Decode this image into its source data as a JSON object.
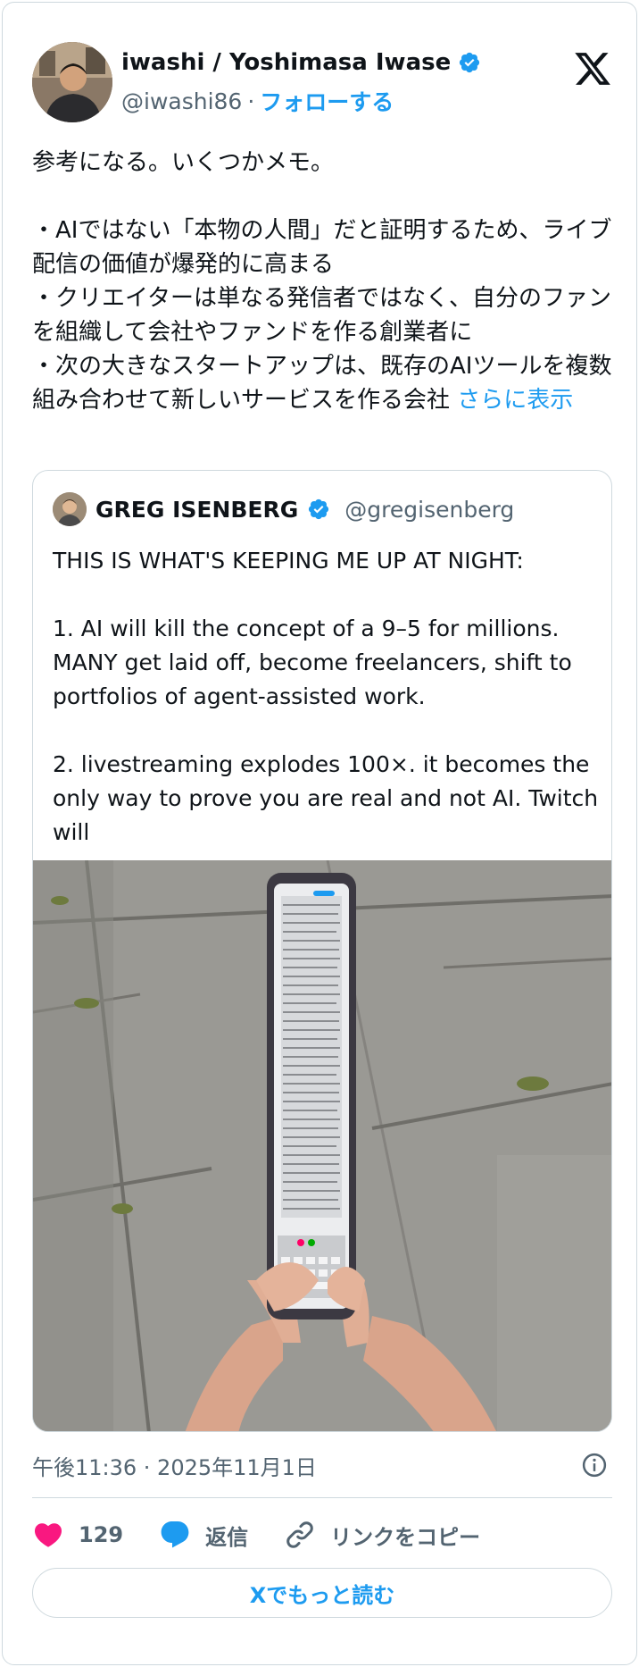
{
  "author": {
    "name": "iwashi / Yoshimasa Iwase",
    "handle": "@iwashi86",
    "separator": "·",
    "follow_label": "フォローする"
  },
  "tweet": {
    "text": "参考になる。いくつかメモ。\n\n・AIではない「本物の人間」だと証明するため、ライブ配信の価値が爆発的に高まる\n・クリエイターは単なる発信者ではなく、自分のファンを組織して会社やファンドを作る創業者に\n・次の大きなスタートアップは、既存のAIツールを複数組み合わせて新しいサービスを作る会社 ",
    "show_more": "さらに表示"
  },
  "quote": {
    "name": "GREG ISENBERG",
    "handle": "@gregisenberg",
    "text": "THIS IS WHAT'S KEEPING ME UP AT NIGHT:\n\n1. AI will kill the concept of a 9–5 for millions. MANY get laid off, become freelancers, shift to portfolios of agent-assisted work.\n\n2. livestreaming explodes 100×. it becomes the only way to prove you are real and not AI. Twitch will"
  },
  "footer": {
    "timestamp": "午後11:36 · 2025年11月1日",
    "like_count": "129",
    "reply_label": "返信",
    "copy_link_label": "リンクをコピー",
    "read_more_label": "Xでもっと読む"
  },
  "colors": {
    "accent": "#1d9bf0",
    "like": "#f91880",
    "text": "#0f1419",
    "muted": "#536471",
    "border": "#cfd9de"
  },
  "icons": [
    "verified-badge-icon",
    "x-logo-icon",
    "info-icon",
    "heart-icon",
    "reply-bubble-icon",
    "link-icon"
  ]
}
